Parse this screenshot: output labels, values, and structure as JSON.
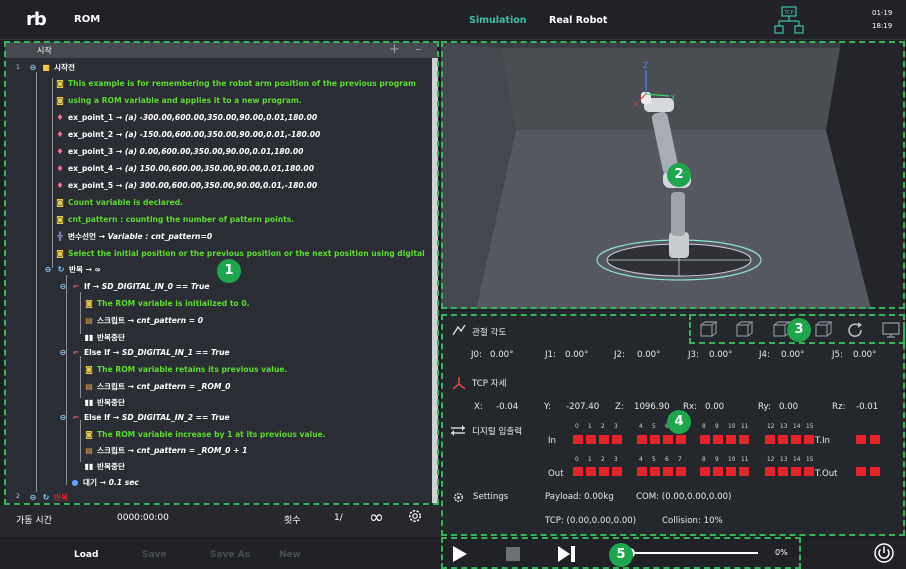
{
  "header": {
    "logo_text": "rb",
    "app_title": "ROM",
    "mode_simulation": "Simulation",
    "mode_real": "Real Robot",
    "tcp_badge": "TCP",
    "date": "01-19",
    "time": "18:19"
  },
  "program_tree": {
    "header_title": "시작",
    "add_glyph": "+",
    "min_glyph": "–",
    "line_1": "1",
    "line_2": "2",
    "root_label": "시작전",
    "comment_1": "This example is for remembering the robot arm position of the previous program",
    "comment_2": "using a ROM variable and applies it to a new program.",
    "points": [
      {
        "name": "ex_point_1",
        "value": "→ (a) -300.00,600.00,350.00,90.00,0.01,180.00"
      },
      {
        "name": "ex_point_2",
        "value": "→ (a) -150.00,600.00,350.00,90.00,0.01,-180.00"
      },
      {
        "name": "ex_point_3",
        "value": "→ (a) 0.00,600.00,350.00,90.00,0.01,180.00"
      },
      {
        "name": "ex_point_4",
        "value": "→ (a) 150.00,600.00,350.00,90.00,0.01,180.00"
      },
      {
        "name": "ex_point_5",
        "value": "→ (a) 300.00,600.00,350.00,90.00,0.01,-180.00"
      }
    ],
    "comment_3": "Count variable is declared.",
    "comment_4": "cnt_pattern : counting the number of pattern points.",
    "var_decl_label": "변수선언",
    "var_decl_value": "→ Variable : cnt_pattern=0",
    "comment_5": "Select the initial position or the previous position or the next position using digital",
    "loop_label": "반복",
    "loop_value": "→ ∞",
    "if_label": "If",
    "if_value": "→ SD_DIGITAL_IN_0 == True",
    "if_comment": "The ROM variable is initialized to 0.",
    "script_label": "스크립트",
    "if_script": "→ cnt_pattern = 0",
    "break_label": "반복중단",
    "elseif1_label": "Else If",
    "elseif1_value": "→ SD_DIGITAL_IN_1 == True",
    "elseif1_comment": "The ROM variable retains its previous value.",
    "elseif1_script": "→ cnt_pattern = _ROM_0",
    "elseif2_label": "Else If",
    "elseif2_value": "→ SD_DIGITAL_IN_2 == True",
    "elseif2_comment": "The ROM variable increase by 1 at its previous value.",
    "elseif2_script": "→ cnt_pattern = _ROM_0 + 1",
    "wait_label": "대기",
    "wait_value": "→ 0.1 sec",
    "line2_label": "반복"
  },
  "status": {
    "run_time_label": "가동 시간",
    "run_time_value": "0000:00:00",
    "count_label": "횟수",
    "count_value": "1/",
    "loop_glyph": "∞"
  },
  "actions": {
    "load": "Load",
    "save": "Save",
    "save_as": "Save As",
    "new": "New"
  },
  "joint_section": {
    "title": "관절 각도",
    "joints": [
      {
        "label": "J0:",
        "value": "0.00°"
      },
      {
        "label": "J1:",
        "value": "0.00°"
      },
      {
        "label": "J2:",
        "value": "0.00°"
      },
      {
        "label": "J3:",
        "value": "0.00°"
      },
      {
        "label": "J4:",
        "value": "0.00°"
      },
      {
        "label": "J5:",
        "value": "0.00°"
      }
    ]
  },
  "tcp_section": {
    "title": "TCP 자세",
    "x_label": "X:",
    "x_value": "-0.04",
    "y_label": "Y:",
    "y_value": "-207.40",
    "z_label": "Z:",
    "z_value": "1096.90",
    "rx_label": "Rx:",
    "rx_value": "0.00",
    "ry_label": "Ry:",
    "ry_value": "0.00",
    "rz_label": "Rz:",
    "rz_value": "-0.01"
  },
  "io_section": {
    "title": "디지털 입출력",
    "in_label": "In",
    "out_label": "Out",
    "tin_label": "T.In",
    "tout_label": "T.Out",
    "channel_numbers": [
      "0",
      "1",
      "2",
      "3",
      "4",
      "5",
      "6",
      "7",
      "8",
      "9",
      "10",
      "11",
      "12",
      "13",
      "14",
      "15"
    ]
  },
  "settings_section": {
    "title": "Settings",
    "payload": "Payload: 0.00kg",
    "com": "COM: (0.00,0.00,0.00)",
    "tcp": "TCP: (0.00,0.00,0.00)",
    "collision": "Collision: 10%"
  },
  "playback": {
    "progress_percent": 0,
    "progress_text": "0%"
  },
  "scene_axes": {
    "z": "Z",
    "x": "X",
    "y": "Y"
  },
  "callouts": [
    "1",
    "2",
    "3",
    "4",
    "5"
  ],
  "colors": {
    "accent_green": "#35b55a",
    "comment_green": "#5ddc2f",
    "io_red": "#e4232b",
    "simulation_teal": "#3fc0a5"
  }
}
